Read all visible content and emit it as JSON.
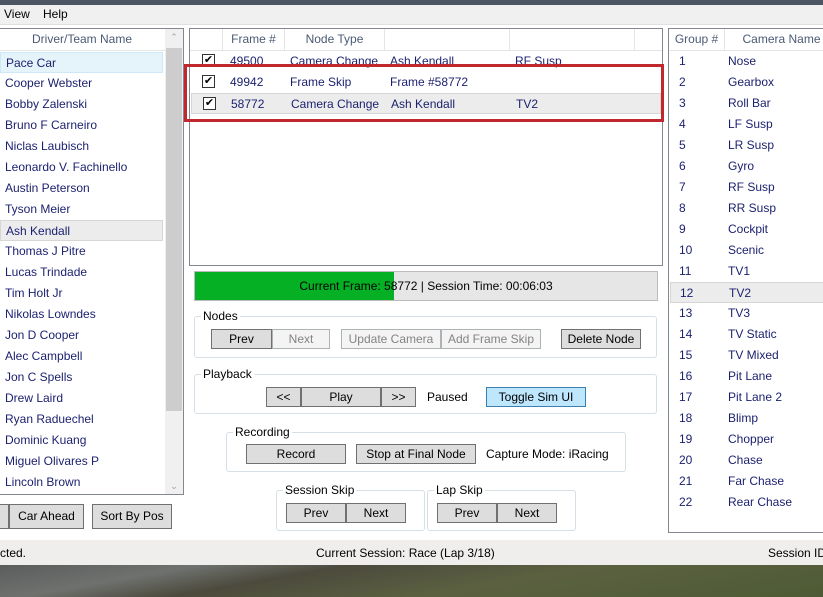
{
  "menu": [
    {
      "label": "View"
    },
    {
      "label": "Help"
    }
  ],
  "drivers": {
    "header": "Driver/Team Name",
    "items": [
      {
        "name": "Pace Car",
        "state": "selected-light"
      },
      {
        "name": "Cooper Webster"
      },
      {
        "name": "Bobby Zalenski"
      },
      {
        "name": "Bruno F Carneiro"
      },
      {
        "name": "Niclas Laubisch"
      },
      {
        "name": "Leonardo V. Fachinello"
      },
      {
        "name": "Austin Peterson"
      },
      {
        "name": "Tyson Meier"
      },
      {
        "name": "Ash Kendall",
        "state": "selected"
      },
      {
        "name": "Thomas J Pitre"
      },
      {
        "name": "Lucas Trindade"
      },
      {
        "name": "Tim Holt Jr"
      },
      {
        "name": "Nikolas Lowndes"
      },
      {
        "name": "Jon D Cooper"
      },
      {
        "name": "Alec Campbell"
      },
      {
        "name": "Jon C Spells"
      },
      {
        "name": "Drew Laird"
      },
      {
        "name": "Ryan Raduechel"
      },
      {
        "name": "Dominic Kuang"
      },
      {
        "name": "Miguel Olivares P"
      },
      {
        "name": "Lincoln Brown"
      }
    ],
    "buttons": {
      "car_ahead": "Car Ahead",
      "sort_by_pos": "Sort By Pos"
    }
  },
  "nodes_table": {
    "columns": [
      "",
      "Frame #",
      "Node Type",
      "",
      ""
    ],
    "rows": [
      {
        "checked": true,
        "frame": "49500",
        "type": "Camera Change",
        "target": "Ash Kendall",
        "camera": "RF Susp"
      },
      {
        "checked": true,
        "frame": "49942",
        "type": "Frame Skip",
        "target": "Frame #58772",
        "camera": ""
      },
      {
        "checked": true,
        "frame": "58772",
        "type": "Camera Change",
        "target": "Ash Kendall",
        "camera": "TV2",
        "selected": true
      }
    ]
  },
  "progress": {
    "text": "Current Frame: 58772 | Session Time: 00:06:03",
    "fraction": 0.43,
    "color": "#06b025"
  },
  "nodes_group": {
    "label": "Nodes",
    "prev": "Prev",
    "next": "Next",
    "update_camera": "Update Camera",
    "add_frame_skip": "Add Frame Skip",
    "delete_node": "Delete Node"
  },
  "playback_group": {
    "label": "Playback",
    "rewind": "<<",
    "play": "Play",
    "forward": ">>",
    "status": "Paused",
    "toggle_sim_ui": "Toggle Sim UI"
  },
  "recording_group": {
    "label": "Recording",
    "record": "Record",
    "stop_at_final_node": "Stop at Final Node",
    "capture_mode": "Capture Mode: iRacing"
  },
  "session_skip": {
    "label": "Session Skip",
    "prev": "Prev",
    "next": "Next"
  },
  "lap_skip": {
    "label": "Lap Skip",
    "prev": "Prev",
    "next": "Next"
  },
  "cameras": {
    "columns": [
      "Group #",
      "Camera Name"
    ],
    "rows": [
      {
        "group": "1",
        "name": "Nose"
      },
      {
        "group": "2",
        "name": "Gearbox"
      },
      {
        "group": "3",
        "name": "Roll Bar"
      },
      {
        "group": "4",
        "name": "LF Susp"
      },
      {
        "group": "5",
        "name": "LR Susp"
      },
      {
        "group": "6",
        "name": "Gyro"
      },
      {
        "group": "7",
        "name": "RF Susp"
      },
      {
        "group": "8",
        "name": "RR Susp"
      },
      {
        "group": "9",
        "name": "Cockpit"
      },
      {
        "group": "10",
        "name": "Scenic"
      },
      {
        "group": "11",
        "name": "TV1"
      },
      {
        "group": "12",
        "name": "TV2",
        "selected": true
      },
      {
        "group": "13",
        "name": "TV3"
      },
      {
        "group": "14",
        "name": "TV Static"
      },
      {
        "group": "15",
        "name": "TV Mixed"
      },
      {
        "group": "16",
        "name": "Pit Lane"
      },
      {
        "group": "17",
        "name": "Pit Lane 2"
      },
      {
        "group": "18",
        "name": "Blimp"
      },
      {
        "group": "19",
        "name": "Chopper"
      },
      {
        "group": "20",
        "name": "Chase"
      },
      {
        "group": "21",
        "name": "Far Chase"
      },
      {
        "group": "22",
        "name": "Rear Chase"
      }
    ]
  },
  "statusbar": {
    "left": "cted.",
    "center": "Current Session: Race (Lap 3/18)",
    "right": "Session ID"
  }
}
